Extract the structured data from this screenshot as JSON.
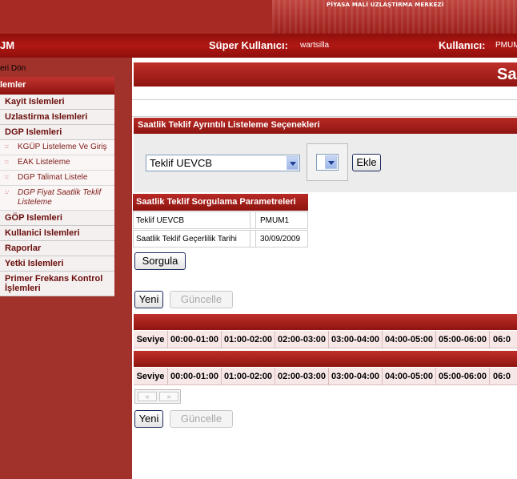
{
  "header": {
    "brand": "PİYASA MALİ UZLAŞTIRMA MERKEZİ",
    "app_abbr": "JM",
    "super_user_label": "Süper Kullanıcı:",
    "super_user_value": "wartsilla",
    "user_label": "Kullanıcı:",
    "user_value": "PMUM"
  },
  "sidebar": {
    "back_label": "eri Dön",
    "group_label": "lemler",
    "items": [
      {
        "label": "Kayit Islemleri",
        "type": "item"
      },
      {
        "label": "Uzlastirma Islemleri",
        "type": "item"
      },
      {
        "label": "DGP Islemleri",
        "type": "item"
      },
      {
        "label": "KGÜP Listeleme Ve Giriş",
        "type": "sub"
      },
      {
        "label": "EAK Listeleme",
        "type": "sub"
      },
      {
        "label": "DGP Talimat Listele",
        "type": "sub"
      },
      {
        "label": "DGP Fiyat Saatlik Teklif Listeleme",
        "type": "sub-italic"
      },
      {
        "label": "GÖP Islemleri",
        "type": "item"
      },
      {
        "label": "Kullanici Islemleri",
        "type": "item"
      },
      {
        "label": "Raporlar",
        "type": "item"
      },
      {
        "label": "Yetki Islemleri",
        "type": "item"
      },
      {
        "label": "Primer Frekans Kontrol İşlemleri",
        "type": "item"
      }
    ]
  },
  "main": {
    "page_title": "Sa",
    "options_panel": {
      "title": "Saatlik Teklif Ayrıntılı Listeleme Seçenekleri",
      "select_value": "Teklif UEVCB",
      "small_select_value": "",
      "add_label": "Ekle"
    },
    "query_panel": {
      "title": "Saatlik Teklif Sorgulama Parametreleri",
      "rows": [
        {
          "key": "Teklif UEVCB",
          "value": "PMUM1"
        },
        {
          "key": "Saatlik Teklif Geçerlilik Tarihi",
          "value": "30/09/2009"
        }
      ],
      "query_label": "Sorgula"
    },
    "actions": {
      "new_label": "Yeni",
      "update_label": "Güncelle"
    },
    "grid": {
      "columns": [
        "Seviye",
        "00:00-01:00",
        "01:00-02:00",
        "02:00-03:00",
        "03:00-04:00",
        "04:00-05:00",
        "05:00-06:00",
        "06:0"
      ]
    },
    "pager": {
      "prev": "«",
      "next": "»"
    }
  },
  "colors": {
    "brand_red": "#a82a24",
    "dark_red": "#8e1410",
    "row_pink": "#f7e7e7"
  }
}
